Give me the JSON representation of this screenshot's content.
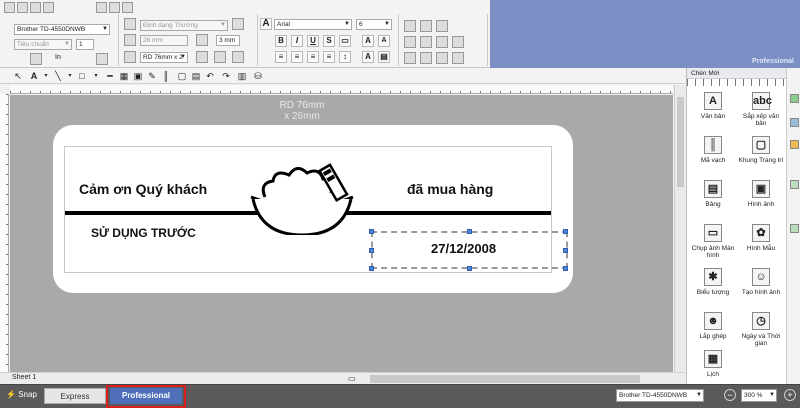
{
  "ribbon": {
    "printer_combo": "Brother TD-4550DNWB",
    "quality_combo": "Tiêu chuẩn",
    "copies": "1",
    "print_label": "In",
    "style_combo": "Định dạng Thường",
    "length_value": "26 mm",
    "margin_value": "3 mm",
    "media_combo": "RD 76mm x 2",
    "font_combo": "Arial",
    "font_size": "6",
    "bold": "B",
    "italic": "I",
    "underline": "U",
    "edition": "Professional"
  },
  "canvas": {
    "size_line1": "RD 76mm",
    "size_line2": "x 26mm",
    "text_thanks": "Cảm ơn Quý khách",
    "text_purchased": "đã mua hàng",
    "text_use_before": "SỬ DỤNG TRƯỚC",
    "text_date": "27/12/2008"
  },
  "sheet_tab": "Sheet 1",
  "palette": {
    "header": "Chèn Mới",
    "items": [
      {
        "label": "Văn bản",
        "icon": "text-icon"
      },
      {
        "label": "Sắp xếp văn bản",
        "icon": "arrange-text-icon"
      },
      {
        "label": "Mã vạch",
        "icon": "barcode-icon"
      },
      {
        "label": "Khung Trang trí",
        "icon": "frame-icon"
      },
      {
        "label": "Bảng",
        "icon": "table-icon"
      },
      {
        "label": "Hình ảnh",
        "icon": "image-icon"
      },
      {
        "label": "Chụp ảnh Màn hình",
        "icon": "screen-capture-icon"
      },
      {
        "label": "Hình Mẫu",
        "icon": "clip-art-icon"
      },
      {
        "label": "Biểu tượng",
        "icon": "symbol-icon"
      },
      {
        "label": "Tạo hình ảnh",
        "icon": "make-image-icon"
      },
      {
        "label": "Lắp ghép",
        "icon": "merge-icon"
      },
      {
        "label": "Ngày và Thời gian",
        "icon": "date-time-icon"
      },
      {
        "label": "Lịch",
        "icon": "calendar-icon"
      }
    ]
  },
  "status": {
    "snap": "Snap",
    "mode_express": "Express",
    "mode_professional": "Professional",
    "printer": "Brother TD-4550DNWB",
    "zoom": "300 %",
    "zoom_out": "−",
    "zoom_in": "+"
  },
  "colors": {
    "accent_blue": "#4f6fb8",
    "highlight_red": "#d91f1f",
    "ribbon_blue": "#7b8fc4"
  }
}
